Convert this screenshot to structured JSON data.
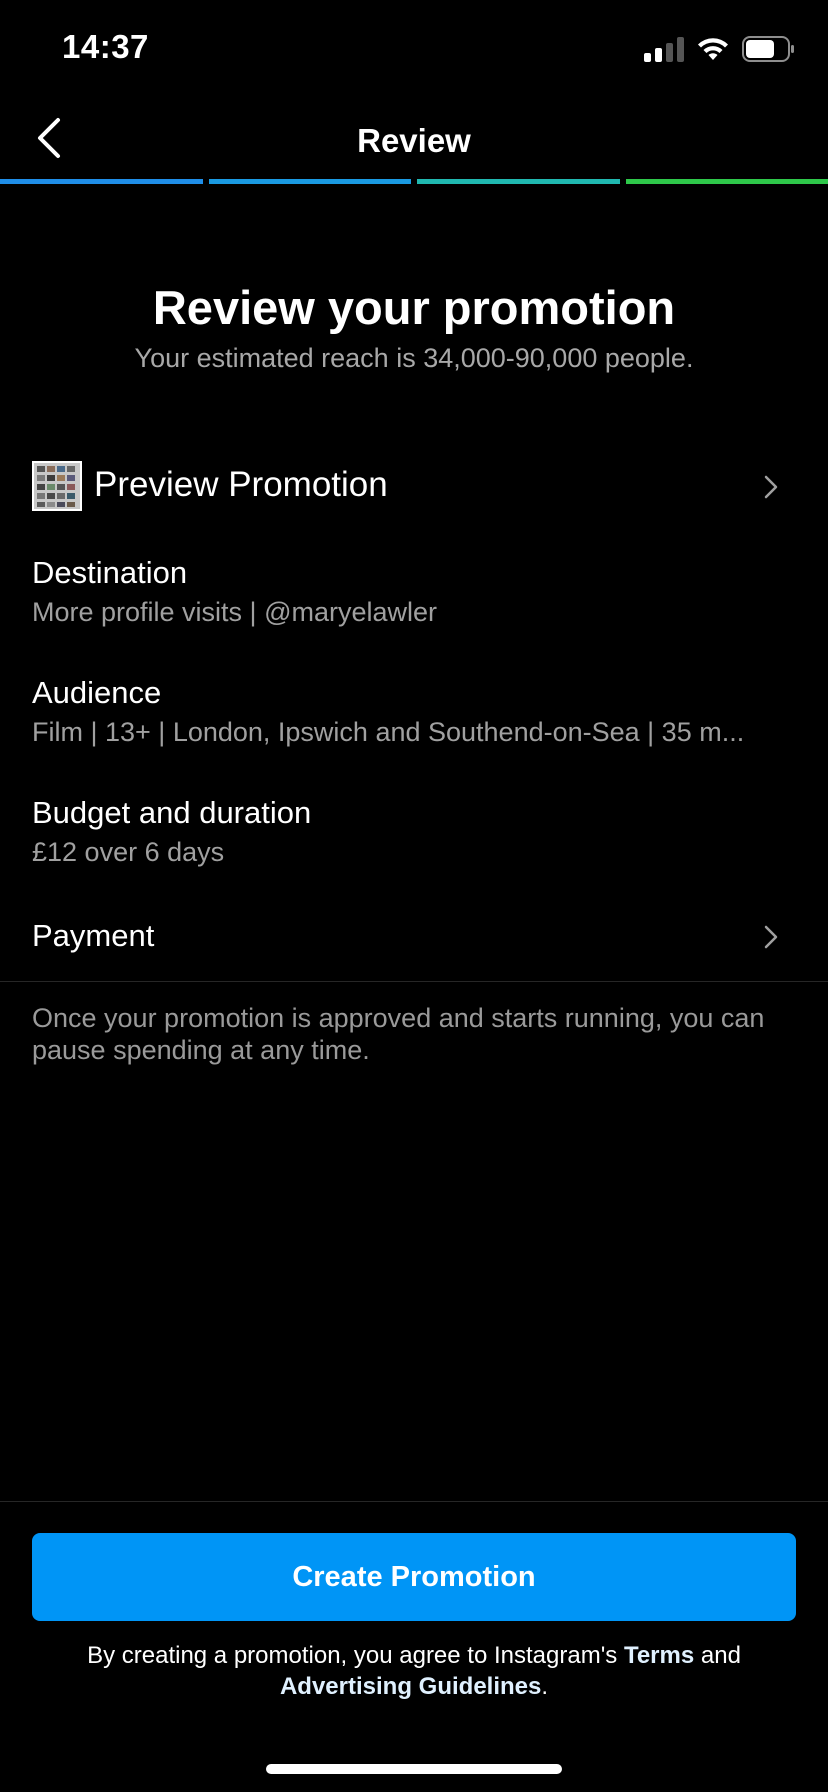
{
  "status_bar": {
    "time": "14:37"
  },
  "nav": {
    "title": "Review",
    "progress_colors": [
      "#1f8ee8",
      "#1a9ae2",
      "#20b8b0",
      "#2ec84a"
    ]
  },
  "hero": {
    "title": "Review your promotion",
    "subtitle": "Your estimated reach is 34,000-90,000 people."
  },
  "rows": {
    "preview": {
      "title": "Preview Promotion"
    },
    "destination": {
      "title": "Destination",
      "subtitle": "More profile visits | @maryelawler"
    },
    "audience": {
      "title": "Audience",
      "subtitle": "Film | 13+ | London, Ipswich and Southend-on-Sea | 35 m..."
    },
    "budget": {
      "title": "Budget and duration",
      "subtitle": "£12 over 6 days"
    },
    "payment": {
      "title": "Payment"
    }
  },
  "note": "Once your promotion is approved and starts running, you can pause spending at any time.",
  "cta": {
    "label": "Create Promotion"
  },
  "legal": {
    "prefix": "By creating a promotion, you agree to Instagram's ",
    "terms_link": "Terms",
    "middle": " and ",
    "guidelines_link": "Advertising Guidelines",
    "suffix": "."
  },
  "colors": {
    "accent": "#0095f6",
    "background": "#000000",
    "secondary_text": "#a8a8a8"
  }
}
